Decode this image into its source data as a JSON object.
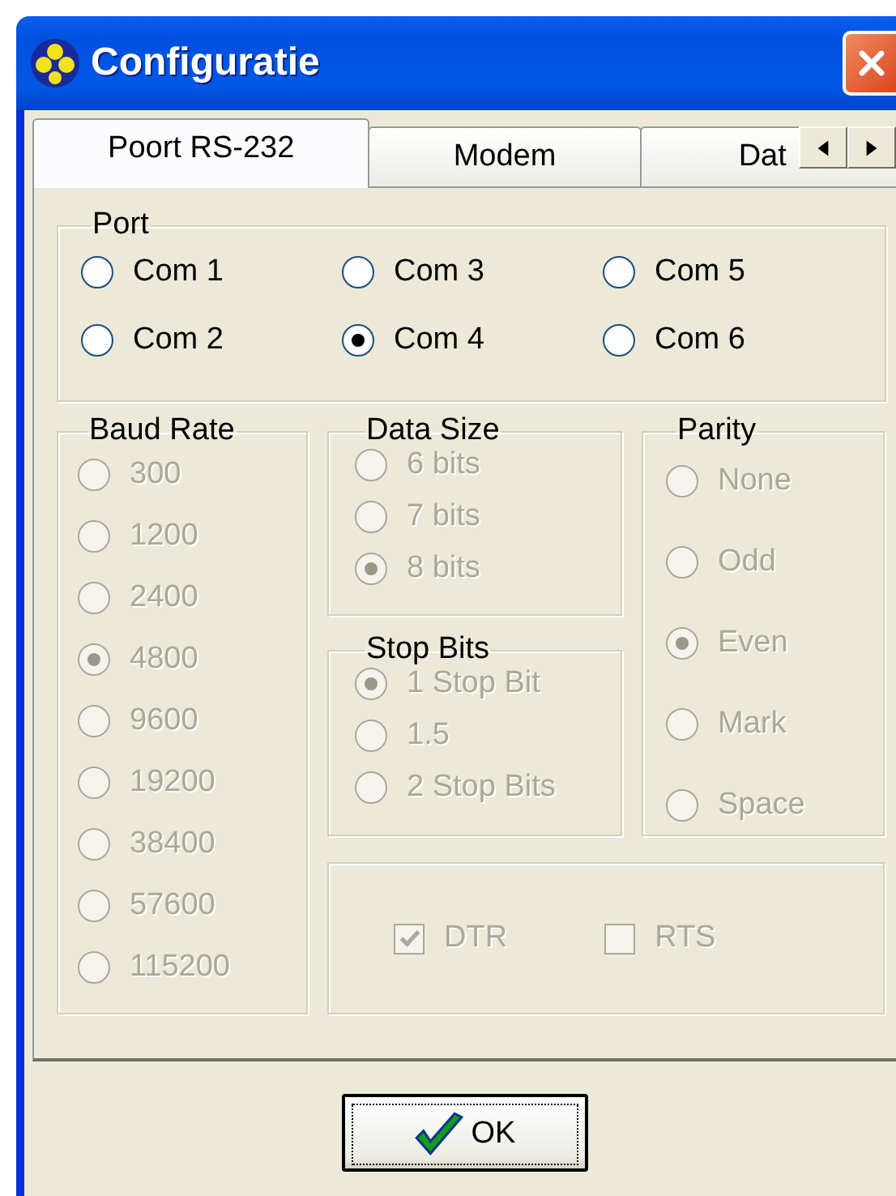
{
  "window": {
    "title": "Configuratie"
  },
  "tabs": [
    {
      "label": "Poort RS-232",
      "selected": true
    },
    {
      "label": "Modem",
      "selected": false
    },
    {
      "label": "Dat",
      "selected": false
    }
  ],
  "port": {
    "label": "Port",
    "disabled": false,
    "options": [
      {
        "label": "Com 1",
        "selected": false
      },
      {
        "label": "Com 3",
        "selected": false
      },
      {
        "label": "Com 5",
        "selected": false
      },
      {
        "label": "Com 2",
        "selected": false
      },
      {
        "label": "Com 4",
        "selected": true
      },
      {
        "label": "Com 6",
        "selected": false
      }
    ]
  },
  "baud_rate": {
    "label": "Baud Rate",
    "disabled": true,
    "options": [
      {
        "label": "300",
        "selected": false
      },
      {
        "label": "1200",
        "selected": false
      },
      {
        "label": "2400",
        "selected": false
      },
      {
        "label": "4800",
        "selected": true
      },
      {
        "label": "9600",
        "selected": false
      },
      {
        "label": "19200",
        "selected": false
      },
      {
        "label": "38400",
        "selected": false
      },
      {
        "label": "57600",
        "selected": false
      },
      {
        "label": "115200",
        "selected": false
      }
    ]
  },
  "data_size": {
    "label": "Data Size",
    "disabled": true,
    "options": [
      {
        "label": "6 bits",
        "selected": false
      },
      {
        "label": "7 bits",
        "selected": false
      },
      {
        "label": "8 bits",
        "selected": true
      }
    ]
  },
  "stop_bits": {
    "label": "Stop Bits",
    "disabled": true,
    "options": [
      {
        "label": "1 Stop Bit",
        "selected": true
      },
      {
        "label": "1.5",
        "selected": false
      },
      {
        "label": "2 Stop Bits",
        "selected": false
      }
    ]
  },
  "parity": {
    "label": "Parity",
    "disabled": true,
    "options": [
      {
        "label": "None",
        "selected": false
      },
      {
        "label": "Odd",
        "selected": false
      },
      {
        "label": "Even",
        "selected": true
      },
      {
        "label": "Mark",
        "selected": false
      },
      {
        "label": "Space",
        "selected": false
      }
    ]
  },
  "handshake": {
    "disabled": true,
    "checkboxes": [
      {
        "label": "DTR",
        "checked": true
      },
      {
        "label": "RTS",
        "checked": false
      }
    ]
  },
  "buttons": [
    {
      "label": "OK"
    }
  ]
}
